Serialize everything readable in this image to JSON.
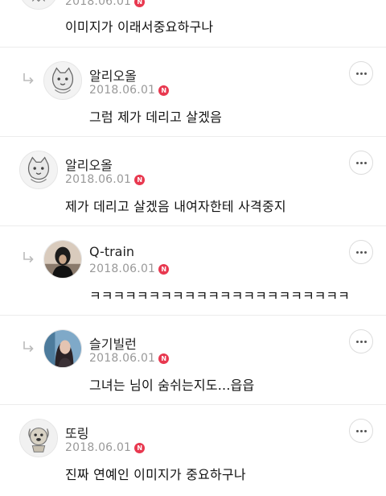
{
  "comments": [
    {
      "date": "2018.06.01",
      "badge": "N",
      "text": "이미지가 이래서중요하구나"
    },
    {
      "nick": "알리오올",
      "date": "2018.06.01",
      "badge": "N",
      "text": "그럼 제가 데리고 살겠음"
    },
    {
      "nick": "알리오올",
      "date": "2018.06.01",
      "badge": "N",
      "text": "제가 데리고 살겠음 내여자한테 사격중지"
    },
    {
      "nick": "Q-train",
      "date": "2018.06.01",
      "badge": "N",
      "text": "ㅋㅋㅋㅋㅋㅋㅋㅋㅋㅋㅋㅋㅋㅋㅋㅋㅋㅋㅋㅋㅋㅋ"
    },
    {
      "nick": "슬기빌런",
      "date": "2018.06.01",
      "badge": "N",
      "text": "그녀는 님이 숨쉬는지도...읍읍"
    },
    {
      "nick": "또링",
      "date": "2018.06.01",
      "badge": "N",
      "text": "진짜 연예인 이미지가 중요하구나"
    }
  ]
}
